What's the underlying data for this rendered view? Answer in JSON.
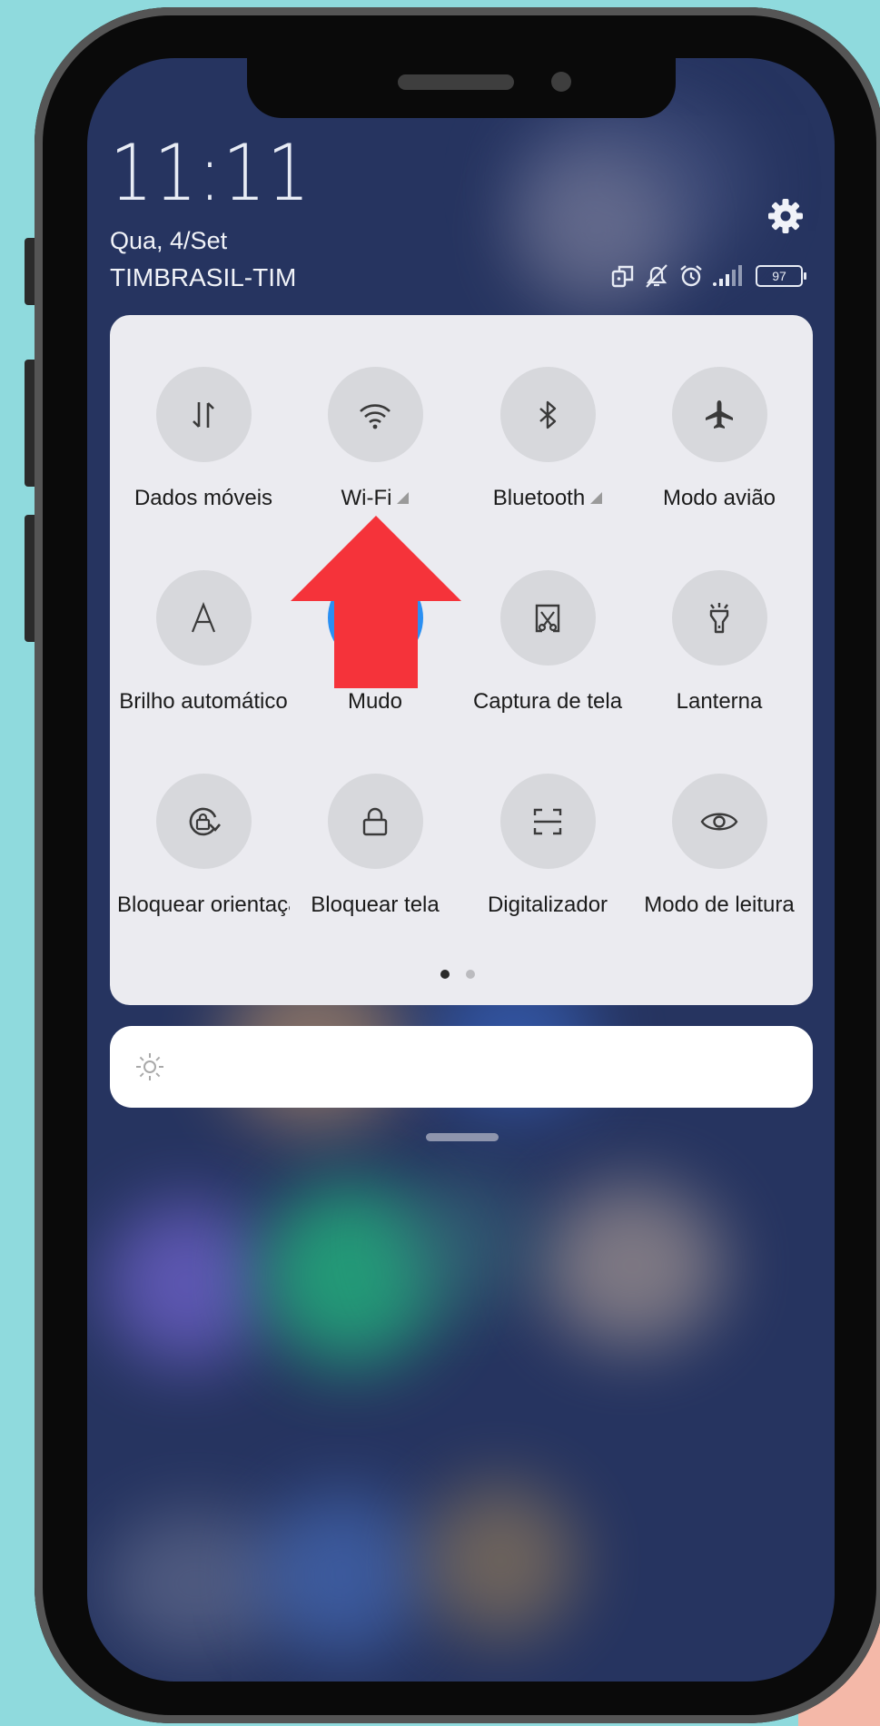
{
  "status": {
    "time": "11:11",
    "date": "Qua, 4/Set",
    "carrier": "TIMBRASIL-TIM",
    "battery": "97",
    "icons": [
      "screen-rotate-icon",
      "bell-muted-icon",
      "alarm-icon",
      "signal-icon",
      "battery-icon"
    ]
  },
  "settings_icon": "gear-icon",
  "tiles": [
    {
      "label": "Dados móveis",
      "icon": "mobile-data-icon",
      "has_arrow": false
    },
    {
      "label": "Wi-Fi",
      "icon": "wifi-icon",
      "has_arrow": true
    },
    {
      "label": "Bluetooth",
      "icon": "bluetooth-icon",
      "has_arrow": true
    },
    {
      "label": "Modo avião",
      "icon": "airplane-icon",
      "has_arrow": false
    },
    {
      "label": "Brilho automático",
      "icon": "auto-brightness-icon",
      "has_arrow": false
    },
    {
      "label": "Mudo",
      "icon": "mute-icon",
      "has_arrow": false
    },
    {
      "label": "Captura de tela",
      "icon": "screenshot-icon",
      "has_arrow": false
    },
    {
      "label": "Lanterna",
      "icon": "flashlight-icon",
      "has_arrow": false
    },
    {
      "label": "Bloquear orientação",
      "icon": "rotation-lock-icon",
      "has_arrow": false
    },
    {
      "label": "Bloquear tela",
      "icon": "lock-icon",
      "has_arrow": false
    },
    {
      "label": "Digitalizador",
      "icon": "scanner-icon",
      "has_arrow": false
    },
    {
      "label": "Modo de leitura",
      "icon": "eye-icon",
      "has_arrow": false
    }
  ],
  "pager": {
    "pages": 2,
    "current": 1
  },
  "brightness_icon": "sun-icon",
  "colors": {
    "background": "#8fdadd",
    "panel": "#ebebf0",
    "tile_circle": "#d7d8dc",
    "accent_arrow": "#f5333a",
    "mute_active": "#2a8ff2"
  }
}
